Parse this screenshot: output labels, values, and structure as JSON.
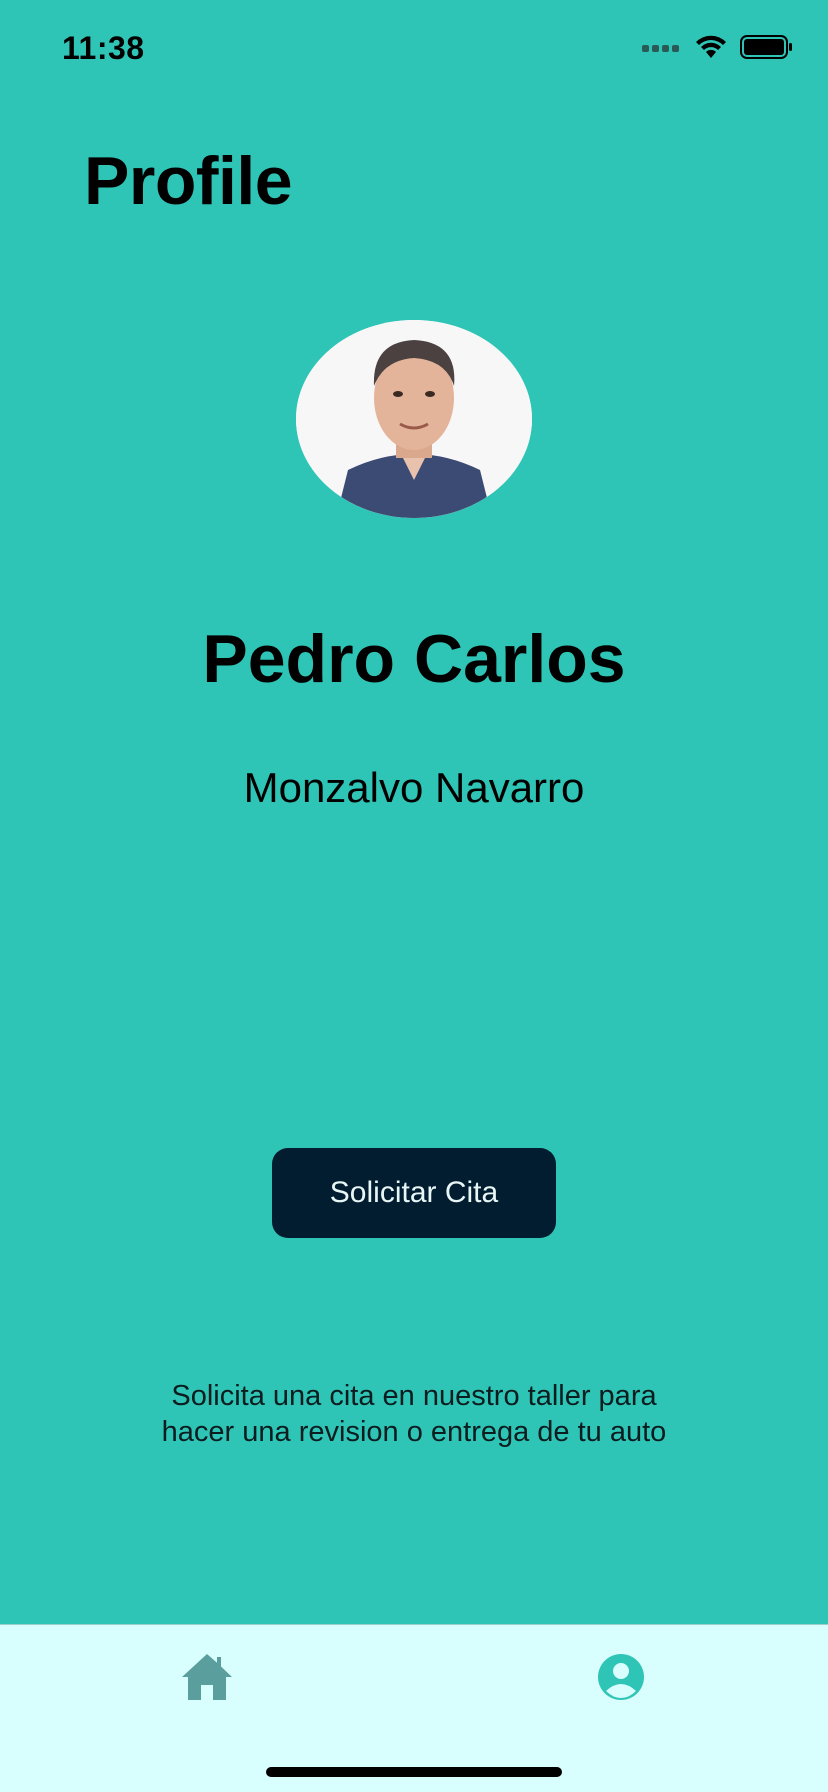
{
  "status_bar": {
    "time": "11:38",
    "icons": [
      "cellular-signal-icon",
      "wifi-icon",
      "battery-icon"
    ]
  },
  "page": {
    "title": "Profile"
  },
  "profile": {
    "avatar_icon": "profile-photo",
    "first_name": "Pedro Carlos",
    "last_name": "Monzalvo Navarro"
  },
  "actions": {
    "request_appointment_label": "Solicitar Cita",
    "description": "Solicita una cita en nuestro taller para hacer una revision o entrega de tu auto"
  },
  "tab_bar": {
    "items": [
      {
        "icon": "home-icon",
        "selected": false
      },
      {
        "icon": "user-circle-icon",
        "selected": true
      }
    ]
  },
  "colors": {
    "background": "#2fc5b6",
    "button": "#021d30",
    "tab_bar": "#d9fefe",
    "tab_active": "#2fc5b6",
    "tab_inactive": "#5a9e9e"
  }
}
